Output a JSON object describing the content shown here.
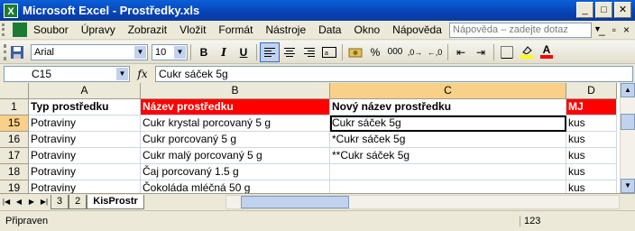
{
  "window": {
    "title": "Microsoft Excel - Prostředky.xls",
    "app_icon": "excel-icon"
  },
  "menubar": {
    "items": [
      "Soubor",
      "Úpravy",
      "Zobrazit",
      "Vložit",
      "Formát",
      "Nástroje",
      "Data",
      "Okno",
      "Nápověda"
    ],
    "help_placeholder": "Nápověda – zadejte dotaz"
  },
  "toolbar": {
    "font_name": "Arial",
    "font_size": "10",
    "bold": "B",
    "italic": "I",
    "underline": "U",
    "percent": "%",
    "thousands": "000",
    "font_color": "A",
    "fill_color": "#ffff00",
    "text_color": "#ff0000"
  },
  "formula_bar": {
    "cell_ref": "C15",
    "fx": "fx",
    "content": "Cukr sáček 5g"
  },
  "grid": {
    "columns": [
      "A",
      "B",
      "C",
      "D"
    ],
    "header_row": {
      "row": "1",
      "cells": [
        "Typ prostředku",
        "Název prostředku",
        "Nový název prostředku",
        "MJ"
      ]
    },
    "rows": [
      {
        "row": "15",
        "cells": [
          "Potraviny",
          "Cukr krystal porcovaný 5 g",
          "Cukr sáček 5g",
          "kus"
        ]
      },
      {
        "row": "16",
        "cells": [
          "Potraviny",
          "Cukr porcovaný 5 g",
          "*Cukr sáček 5g",
          "kus"
        ]
      },
      {
        "row": "17",
        "cells": [
          "Potraviny",
          "Cukr malý porcovaný 5 g",
          "**Cukr sáček 5g",
          "kus"
        ]
      },
      {
        "row": "18",
        "cells": [
          "Potraviny",
          "Čaj porcovaný 1.5 g",
          "",
          "kus"
        ]
      },
      {
        "row": "19",
        "cells": [
          "Potraviny",
          "Čokoláda mléčná 50 g",
          "",
          "kus"
        ]
      }
    ],
    "selected_cell": "C15"
  },
  "sheets": {
    "tabs": [
      "3",
      "2",
      "KisProstr"
    ],
    "active": "KisProstr"
  },
  "status": {
    "text": "Připraven",
    "value": "123"
  }
}
